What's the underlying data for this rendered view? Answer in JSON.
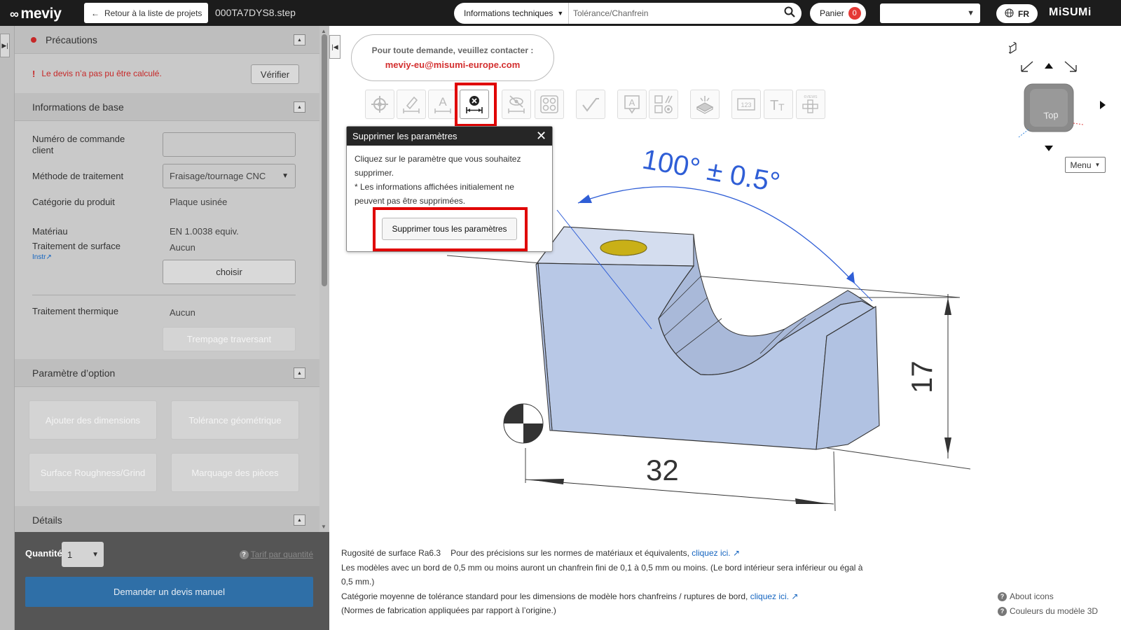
{
  "topbar": {
    "logo": "meviy",
    "back_label": "Retour à la liste de projets",
    "filename": "000TA7DYS8.step",
    "search_category": "Informations techniques",
    "search_placeholder": "Tolérance/Chanfrein",
    "cart_label": "Panier",
    "cart_count": "0",
    "language": "FR",
    "brand": "MiSUMi"
  },
  "left": {
    "precautions": {
      "title": "Précautions",
      "warning": "Le devis n’a pas pu être calculé.",
      "verify_label": "Vérifier"
    },
    "basic_info": {
      "title": "Informations de base",
      "order_number_label": "Numéro de commande client",
      "order_number_value": "",
      "method_label": "Méthode de traitement",
      "method_value": "Fraisage/tournage CNC",
      "category_label": "Catégorie du produit",
      "category_value": "Plaque usinée",
      "material_label": "Matériau",
      "material_value": "EN 1.0038 equiv.",
      "surface_label": "Traitement de surface",
      "surface_value": "Aucun",
      "instr_link": "Instr",
      "choose_label": "choisir",
      "heat_label": "Traitement thermique",
      "heat_value": "Aucun",
      "heat_button": "Trempage traversant"
    },
    "options": {
      "title": "Paramètre d’option",
      "buttons": [
        "Ajouter des dimensions",
        "Tolérance géométrique",
        "Surface Roughness/Grind",
        "Marquage des pièces"
      ]
    },
    "details": {
      "title": "Détails"
    },
    "bottom": {
      "quantity_label": "Quantité",
      "quantity_value": "1",
      "tarif_link": "Tarif par quantité",
      "manual_quote": "Demander un devis manuel"
    }
  },
  "viewer": {
    "contact_title": "Pour toute demande, veuillez contacter :",
    "contact_email": "meviy-eu@misumi-europe.com",
    "toolbar_icons": [
      "origin-icon",
      "dimension-pencil-icon",
      "text-dimension-icon",
      "delete-dimension-icon",
      "hide-dimension-icon",
      "hole-pattern-icon",
      "surface-roughness-icon",
      "annotation-icon",
      "geometric-tolerance-icon",
      "part-marking-icon",
      "ruler-icon",
      "font-size-icon",
      "six-views-icon"
    ],
    "six_views_label": "6VIEWS",
    "popup": {
      "title": "Supprimer les paramètres",
      "line1": "Cliquez sur le paramètre que vous souhaitez supprimer.",
      "line2": "* Les informations affichées initialement ne peuvent pas être supprimées.",
      "button": "Supprimer tous les paramètres"
    },
    "nav_cube_face": "Top",
    "menu_label": "Menu",
    "dimensions": {
      "angle": "100° ± 0.5°",
      "width": "32",
      "height": "17"
    },
    "notes": {
      "roughness": "Rugosité de surface Ra6.3",
      "material_norms": "Pour des précisions sur les normes de matériaux et équivalents,",
      "material_link": "cliquez ici.",
      "chamfer_line1": "Les modèles avec un bord de 0,5 mm ou moins auront un chanfrein fini de 0,1 à 0,5 mm ou moins. (Le bord intérieur sera inférieur ou égal à",
      "chamfer_line2": "0,5 mm.)",
      "tolerance": "Catégorie moyenne de tolérance standard pour les dimensions de modèle hors chanfreins / ruptures de bord,",
      "tolerance_link": "cliquez ici.",
      "origin_note": "(Normes de fabrication appliquées par rapport à l’origine.)"
    },
    "help": {
      "about_icons": "About icons",
      "model_colors": "Couleurs du modèle 3D"
    }
  },
  "colors": {
    "part_fill": "#b8c8e6",
    "dimension_blue": "#2f5ed6",
    "highlight_red": "#e00000",
    "topbar": "#1c1c1c"
  }
}
